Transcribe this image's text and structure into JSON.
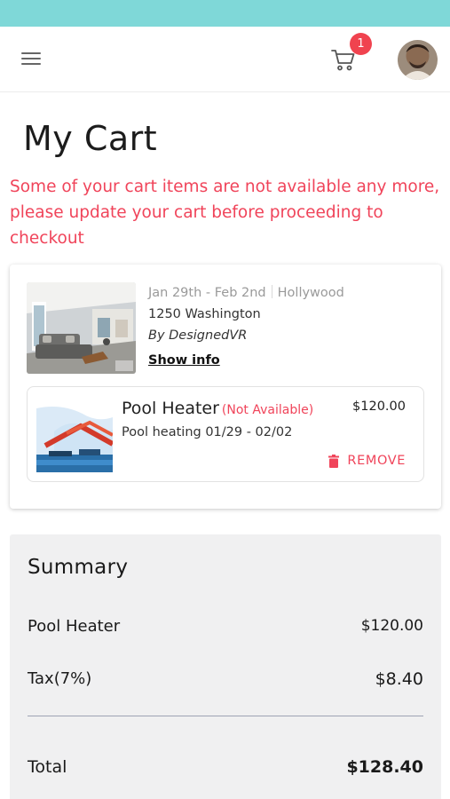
{
  "header": {
    "menu_icon": "hamburger-menu-icon",
    "cart_icon": "shopping-cart-icon",
    "cart_count": "1"
  },
  "page": {
    "title": "My Cart",
    "warning": "Some of your cart items are not available any more, please update your cart before proceeding to checkout"
  },
  "listing": {
    "dates": "Jan 29th - Feb 2nd",
    "location": "Hollywood",
    "address": "1250 Washington",
    "host": "By DesignedVR",
    "show_info_label": "Show info",
    "item": {
      "name": "Pool Heater",
      "status": "(Not Available)",
      "description": "Pool heating 01/29 - 02/02",
      "price": "$120.00",
      "remove_label": "REMOVE"
    }
  },
  "summary": {
    "title": "Summary",
    "lines": [
      {
        "label": "Pool Heater",
        "value": "$120.00"
      },
      {
        "label": "Tax(7%)",
        "value": "$8.40"
      }
    ],
    "total_label": "Total",
    "total_value": "$128.40"
  },
  "colors": {
    "status_bar": "#7fd8d8",
    "accent_red": "#f0445a",
    "summary_bg": "#f0f0f1"
  }
}
